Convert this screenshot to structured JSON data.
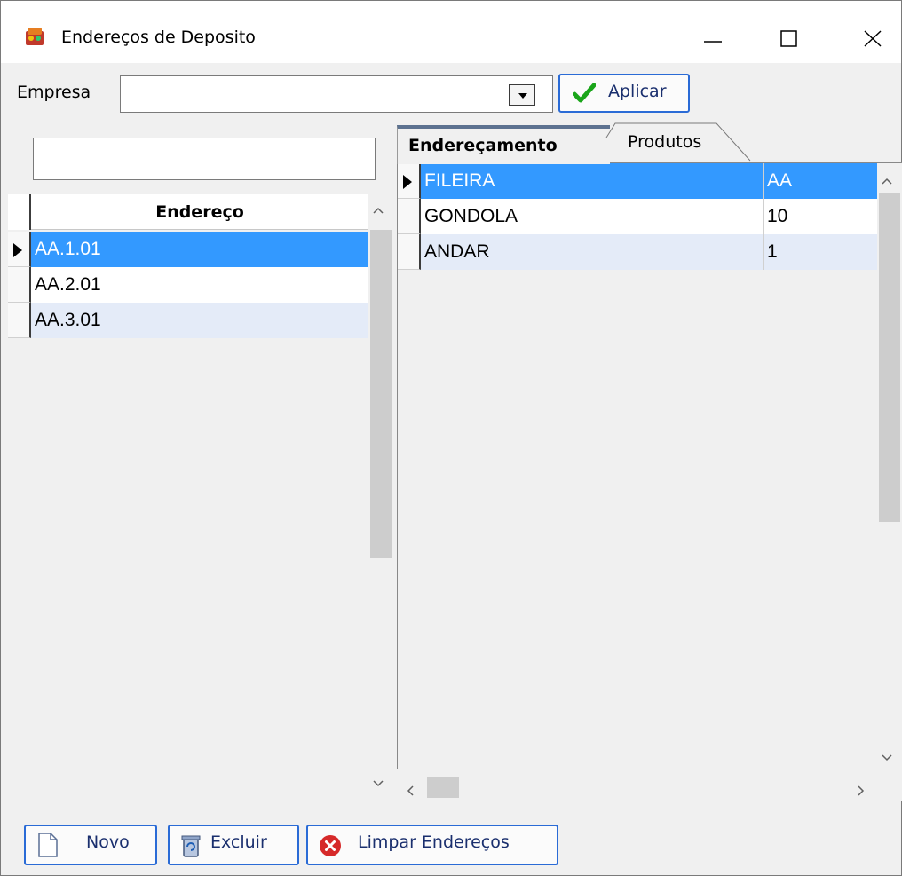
{
  "window": {
    "title": "Endereços de Deposito",
    "controls": {
      "minimize": "minimize",
      "maximize": "maximize",
      "close": "close"
    }
  },
  "empresa": {
    "label": "Empresa",
    "value": "",
    "apply_label": "Aplicar"
  },
  "left": {
    "search_value": "",
    "column_header": "Endereço",
    "rows": [
      {
        "endereco": "AA.1.01",
        "selected": true
      },
      {
        "endereco": "AA.2.01",
        "selected": false
      },
      {
        "endereco": "AA.3.01",
        "selected": false
      }
    ]
  },
  "tabs": {
    "items": [
      {
        "label": "Endereçamento",
        "active": true
      },
      {
        "label": "Produtos",
        "active": false
      }
    ]
  },
  "right": {
    "rows": [
      {
        "name": "FILEIRA",
        "value": "AA",
        "selected": true
      },
      {
        "name": "GONDOLA",
        "value": "10",
        "selected": false
      },
      {
        "name": "ANDAR",
        "value": "1",
        "selected": false
      }
    ]
  },
  "footer": {
    "novo_label": "Novo",
    "excluir_label": "Excluir",
    "limpar_label": "Limpar Endereços"
  },
  "colors": {
    "selection": "#3399ff",
    "alt_row": "#e4ebf8",
    "button_border": "#2a6bd6",
    "tab_active_border": "#5d7290",
    "apply_check": "#1aa51a",
    "clear_icon": "#d62a2a"
  }
}
